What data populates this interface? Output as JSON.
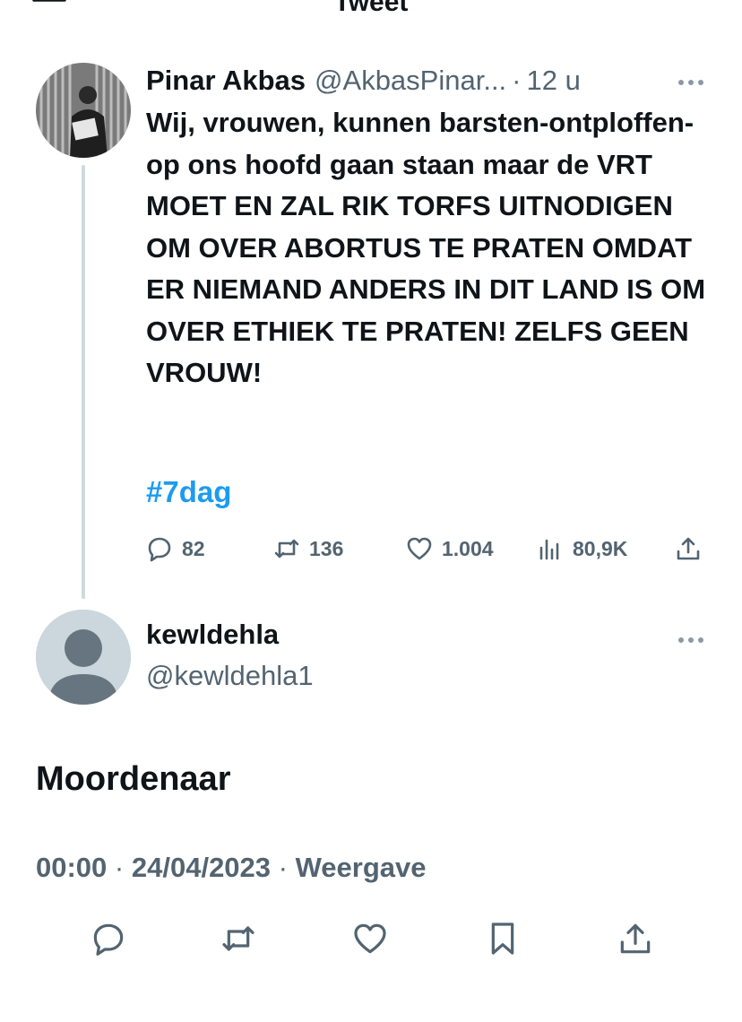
{
  "header": {
    "title": "Tweet"
  },
  "parent_tweet": {
    "author_name": "Pinar Akbas",
    "author_handle": "@AkbasPinar...",
    "separator": "·",
    "time": "12 u",
    "text": "Wij, vrouwen, kunnen barsten-ontploffen-op ons hoofd gaan staan maar de VRT MOET EN ZAL RIK TORFS UITNODIGEN OM OVER ABORTUS TE PRATEN OMDAT ER NIEMAND ANDERS IN DIT LAND IS OM OVER ETHIEK TE PRATEN! ZELFS GEEN VROUW!",
    "hashtag": "#7dag",
    "actions": {
      "replies": "82",
      "retweets": "136",
      "likes": "1.004",
      "views": "80,9K"
    }
  },
  "reply_tweet": {
    "author_name": "kewldehla",
    "author_handle": "@kewldehla1",
    "text": "Moordenaar",
    "time": "00:00",
    "separator": "·",
    "date": "24/04/2023",
    "views_label": "Weergave"
  },
  "icons": {
    "back": "arrow-left-icon",
    "more": "more-horizontal-icon",
    "reply": "reply-icon",
    "retweet": "retweet-icon",
    "like": "heart-icon",
    "views": "views-icon",
    "share": "share-icon",
    "bookmark": "bookmark-icon"
  },
  "colors": {
    "text": "#0f1419",
    "muted": "#536471",
    "link": "#1d9bf0",
    "thread_line": "#cfd9de",
    "default_avatar_bg": "#ccd6dd",
    "default_avatar_fg": "#66757f"
  }
}
